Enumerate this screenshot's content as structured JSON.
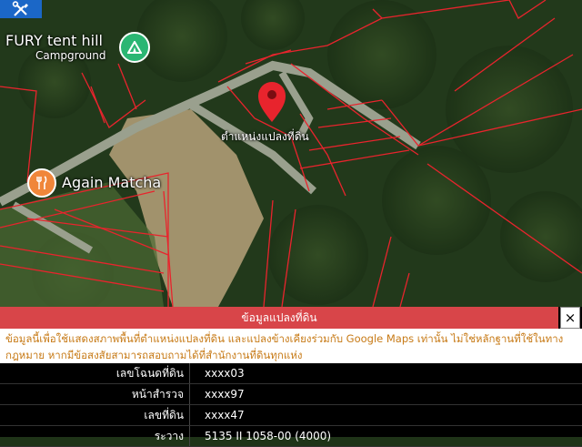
{
  "map": {
    "pois": [
      {
        "name": "FURY tent hill",
        "subtitle": "Campground",
        "icon": "campground-icon",
        "color": "#2bb673"
      },
      {
        "name": "Again Matcha",
        "icon": "restaurant-icon",
        "color": "#f0863a"
      }
    ],
    "parcel_marker_label": "ตำแหน่งแปลงที่ดิน",
    "marker_color": "#e8242d",
    "boundary_color": "#e8242d"
  },
  "toolbar": {
    "tool_icon": "tools-icon"
  },
  "panel": {
    "title": "ข้อมูลแปลงที่ดิน",
    "close_label": "×",
    "disclaimer": "ข้อมูลนี้เพื่อใช้แสดงสภาพพื้นที่ตำแหน่งแปลงที่ดิน และแปลงข้างเคียงร่วมกับ Google Maps เท่านั้น ไม่ใช่หลักฐานที่ใช้ในทางกฎหมาย หากมีข้อสงสัยสามารถสอบถามได้ที่สำนักงานที่ดินทุกแห่ง",
    "rows": [
      {
        "label": "เลขโฉนดที่ดิน",
        "value": "xxxx03"
      },
      {
        "label": "หน้าสำรวจ",
        "value": "xxxx97"
      },
      {
        "label": "เลขที่ดิน",
        "value": "xxxx47"
      },
      {
        "label": "ระวาง",
        "value": "5135 II 1058-00 (4000)"
      }
    ],
    "header_color": "#d84549",
    "disclaimer_color": "#c77a16"
  }
}
